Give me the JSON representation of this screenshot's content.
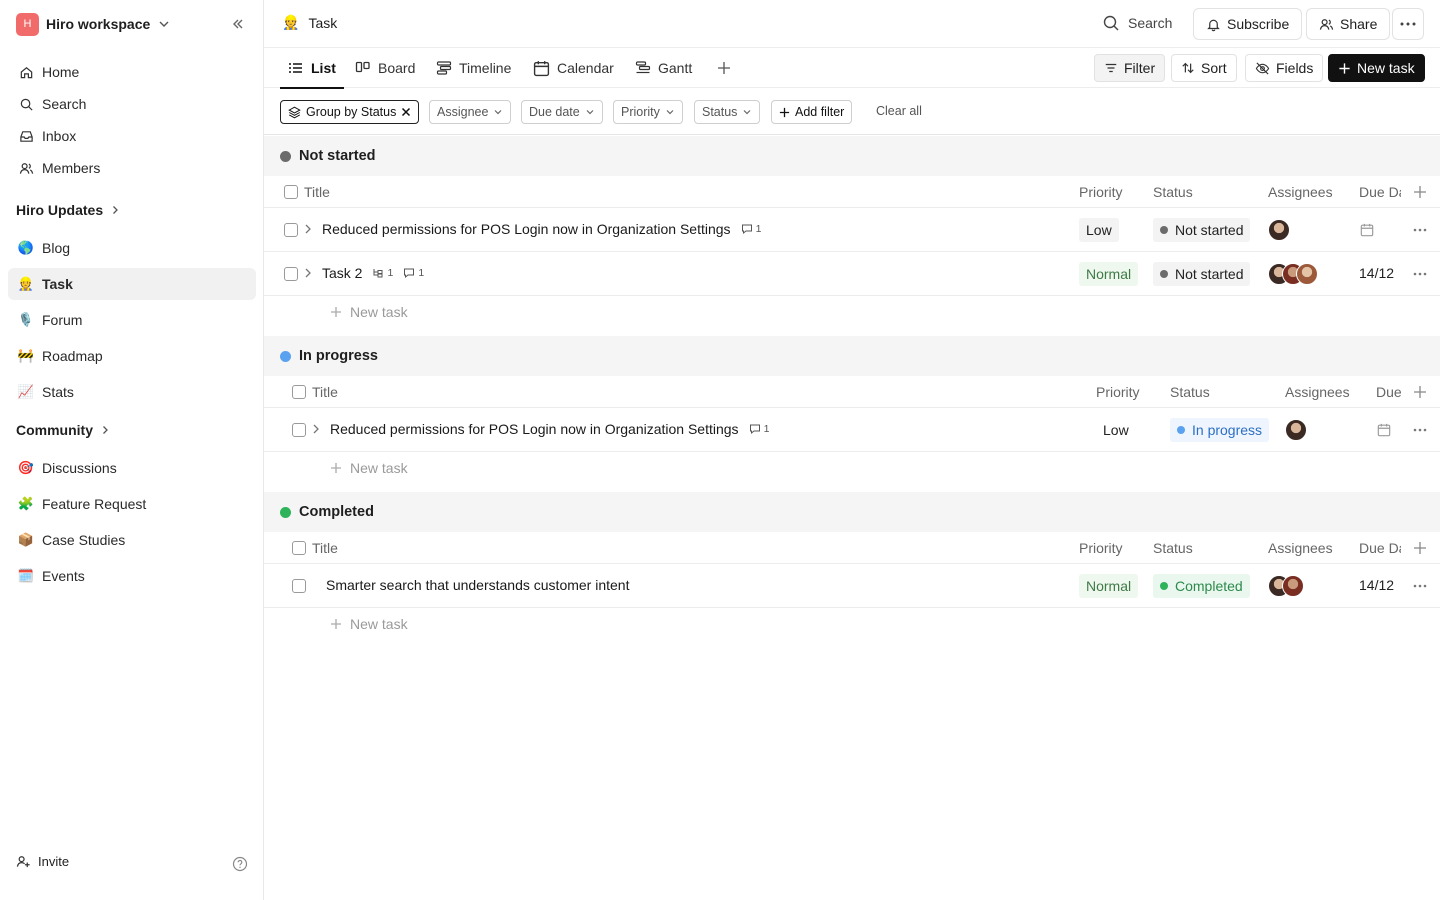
{
  "workspace": {
    "initial": "H",
    "name": "Hiro workspace"
  },
  "sidebar": {
    "main": [
      {
        "label": "Home"
      },
      {
        "label": "Search"
      },
      {
        "label": "Inbox"
      },
      {
        "label": "Members"
      }
    ],
    "section1": {
      "title": "Hiro Updates"
    },
    "updates": [
      {
        "label": "Blog",
        "emoji": "🌎"
      },
      {
        "label": "Task",
        "emoji": "👷"
      },
      {
        "label": "Forum",
        "emoji": "🎙️"
      },
      {
        "label": "Roadmap",
        "emoji": "🚧"
      },
      {
        "label": "Stats",
        "emoji": "📈"
      }
    ],
    "section2": {
      "title": "Community"
    },
    "community": [
      {
        "label": "Discussions",
        "emoji": "🎯"
      },
      {
        "label": "Feature Request",
        "emoji": "🧩"
      },
      {
        "label": "Case Studies",
        "emoji": "📦"
      },
      {
        "label": "Events",
        "emoji": "🗓️"
      }
    ],
    "invite": "Invite"
  },
  "header": {
    "emoji": "👷",
    "title": "Task",
    "search": "Search",
    "subscribe": "Subscribe",
    "share": "Share"
  },
  "toolbar": {
    "tabs": [
      "List",
      "Board",
      "Timeline",
      "Calendar",
      "Gantt"
    ],
    "filter": "Filter",
    "sort": "Sort",
    "fields": "Fields",
    "new_task": "New task"
  },
  "filters": {
    "group_by": "Group by Status",
    "chips": [
      "Assignee",
      "Due date",
      "Priority",
      "Status"
    ],
    "add": "Add filter",
    "clear": "Clear all"
  },
  "columns": {
    "title": "Title",
    "priority": "Priority",
    "status": "Status",
    "assignees": "Assignees",
    "due": "Due Da",
    "due_short": "Due"
  },
  "new_task_label": "New task",
  "groups": [
    {
      "name": "Not started",
      "color": "#6b6b6b",
      "tasks": [
        {
          "title": "Reduced permissions for POS Login now in Organization Settings",
          "comments": "1",
          "priority": "Low",
          "status": "Not started",
          "due": ""
        },
        {
          "title": "Task 2",
          "subtasks": "1",
          "comments": "1",
          "priority": "Normal",
          "status": "Not started",
          "due": "14/12"
        }
      ]
    },
    {
      "name": "In progress",
      "color": "#5aa2f0",
      "tasks": [
        {
          "title": "Reduced permissions for POS Login now in Organization Settings",
          "comments": "1",
          "priority": "Low",
          "status": "In progress",
          "due": ""
        }
      ]
    },
    {
      "name": "Completed",
      "color": "#2fb35a",
      "tasks": [
        {
          "title": "Smarter search that understands customer intent",
          "priority": "Normal",
          "status": "Completed",
          "due": "14/12"
        }
      ]
    }
  ],
  "colors": {
    "status_not_started": "#6b6b6b",
    "status_in_progress": "#5aa2f0",
    "status_completed": "#2fb35a"
  }
}
